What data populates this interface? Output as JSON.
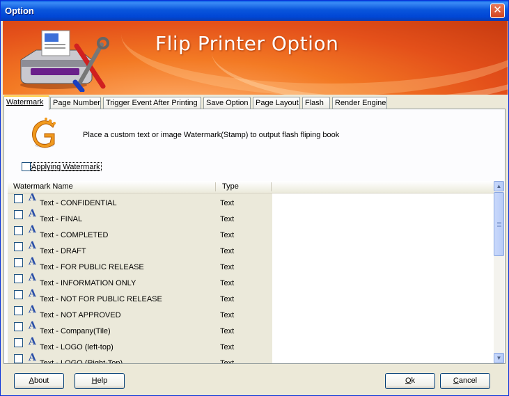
{
  "window": {
    "title": "Option",
    "close_glyph": "✕"
  },
  "banner": {
    "title": "Flip Printer Option"
  },
  "tabs": [
    {
      "label": "Watermark",
      "active": true
    },
    {
      "label": "Page Number"
    },
    {
      "label": "Trigger Event After Printing"
    },
    {
      "label": "Save Option"
    },
    {
      "label": "Page Layout"
    },
    {
      "label": "Flash"
    },
    {
      "label": "Render Engine"
    }
  ],
  "watermark": {
    "description": "Place a custom text or image Watermark(Stamp) to output flash fliping book",
    "apply_label": "Applying Watermark",
    "apply_checked": false
  },
  "list": {
    "columns": {
      "name": "Watermark Name",
      "type": "Type"
    },
    "rows": [
      {
        "name": "Text - CONFIDENTIAL",
        "type": "Text"
      },
      {
        "name": "Text - FINAL",
        "type": "Text"
      },
      {
        "name": "Text - COMPLETED",
        "type": "Text"
      },
      {
        "name": "Text - DRAFT",
        "type": "Text"
      },
      {
        "name": "Text - FOR PUBLIC RELEASE",
        "type": "Text"
      },
      {
        "name": "Text - INFORMATION ONLY",
        "type": "Text"
      },
      {
        "name": "Text - NOT FOR PUBLIC RELEASE",
        "type": "Text"
      },
      {
        "name": "Text - NOT APPROVED",
        "type": "Text"
      },
      {
        "name": "Text - Company(Tile)",
        "type": "Text"
      },
      {
        "name": "Text - LOGO (left-top)",
        "type": "Text"
      },
      {
        "name": "Text - LOGO (Right-Top)",
        "type": "Text"
      }
    ],
    "row_glyph": "A"
  },
  "buttons": {
    "about": {
      "pre": "",
      "u": "A",
      "post": "bout"
    },
    "help": {
      "pre": "",
      "u": "H",
      "post": "elp"
    },
    "ok": {
      "pre": "",
      "u": "O",
      "post": "k"
    },
    "cancel": {
      "pre": "",
      "u": "C",
      "post": "ancel"
    }
  },
  "icons": {
    "close": "close-icon",
    "printer": "printer-tools-icon",
    "info": "watermark-logo-icon",
    "scroll_up": "scroll-up-icon",
    "scroll_down": "scroll-down-icon"
  },
  "colors": {
    "titlebar": "#0a56dc",
    "banner": "#f37a24",
    "accent_tab": "#ffc83c",
    "glyph": "#2a4fa8"
  }
}
